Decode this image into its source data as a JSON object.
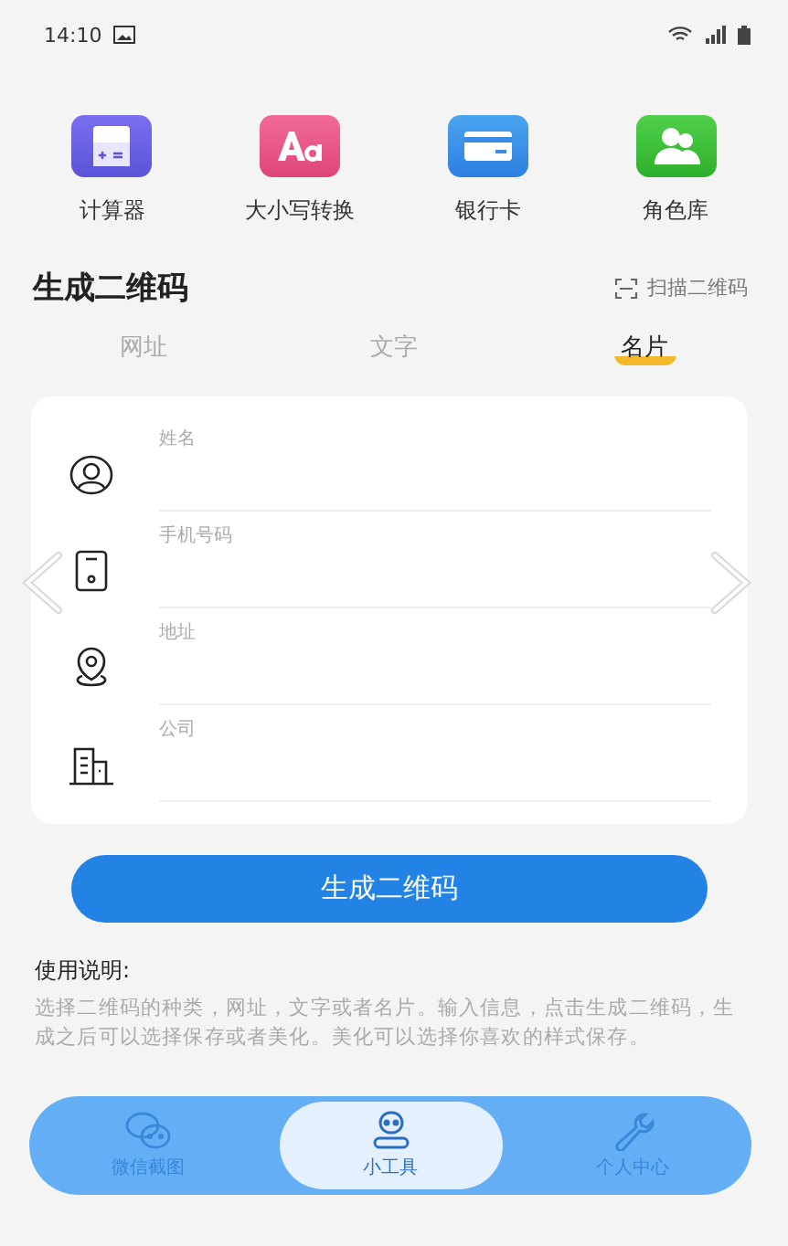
{
  "status_bar": {
    "time": "14:10"
  },
  "tools": [
    {
      "kind": "calculator",
      "label": "计算器"
    },
    {
      "kind": "case",
      "label": "大小写转换"
    },
    {
      "kind": "card",
      "label": "银行卡"
    },
    {
      "kind": "people",
      "label": "角色库"
    }
  ],
  "section": {
    "title": "生成二维码",
    "scan_link": "扫描二维码"
  },
  "tabs": [
    {
      "label": "网址",
      "selected": false
    },
    {
      "label": "文字",
      "selected": false
    },
    {
      "label": "名片",
      "selected": true
    }
  ],
  "fields": [
    {
      "kind": "person",
      "placeholder": "姓名"
    },
    {
      "kind": "phone",
      "placeholder": "手机号码"
    },
    {
      "kind": "location",
      "placeholder": "地址"
    },
    {
      "kind": "building",
      "placeholder": "公司"
    }
  ],
  "generate_button": "生成二维码",
  "instructions": {
    "title": "使用说明:",
    "text": "选择二维码的种类，网址，文字或者名片。输入信息，点击生成二维码，生成之后可以选择保存或者美化。美化可以选择你喜欢的样式保存。"
  },
  "bottom_nav": [
    {
      "kind": "chat",
      "label": "微信截图",
      "selected": false
    },
    {
      "kind": "robot",
      "label": "小工具",
      "selected": true
    },
    {
      "kind": "wrench",
      "label": "个人中心",
      "selected": false
    }
  ]
}
